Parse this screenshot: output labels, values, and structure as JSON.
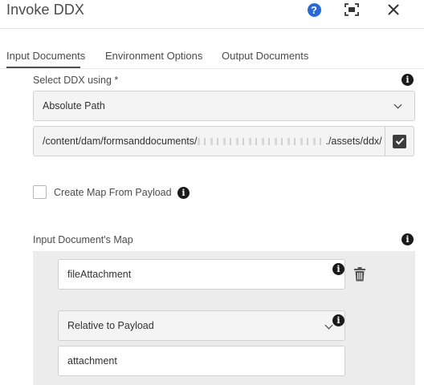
{
  "dialog": {
    "title": "Invoke DDX"
  },
  "header_icons": {
    "help": "?",
    "fullscreen": "fullscreen-icon",
    "close": "close-icon"
  },
  "tabs": [
    {
      "label": "Input Documents",
      "active": true
    },
    {
      "label": "Environment Options",
      "active": false
    },
    {
      "label": "Output Documents",
      "active": false
    }
  ],
  "select_ddx": {
    "label": "Select DDX using *",
    "value": "Absolute Path"
  },
  "ddx_path": {
    "prefix": "/content/dam/formsanddocuments/",
    "suffix": "./assets/ddx/"
  },
  "create_map": {
    "label": "Create Map From Payload",
    "checked": false
  },
  "input_map": {
    "label": "Input Document's Map",
    "entry": {
      "name": "fileAttachment",
      "type": "Relative to Payload",
      "value": "attachment"
    }
  },
  "colors": {
    "accent_help": "#2a68d6",
    "panel_bg": "#ececec"
  }
}
